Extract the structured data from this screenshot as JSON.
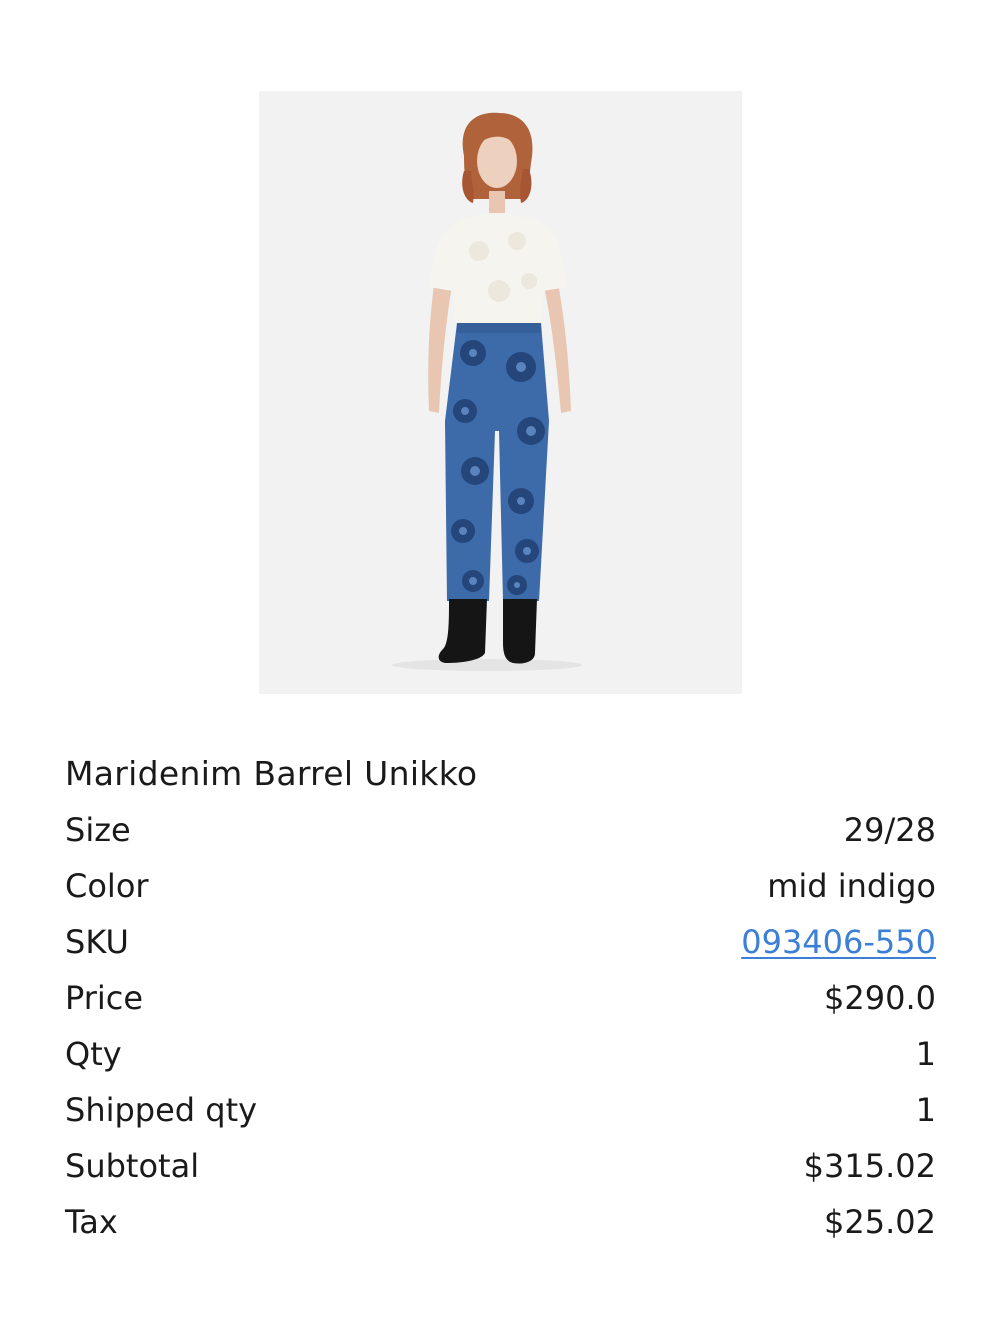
{
  "product": {
    "name": "Maridenim Barrel Unikko",
    "image_alt": "Model wearing Maridenim Barrel Unikko jeans"
  },
  "details": [
    {
      "key": "size",
      "label": "Size",
      "value": "29/28",
      "link": false
    },
    {
      "key": "color",
      "label": "Color",
      "value": "mid indigo",
      "link": false
    },
    {
      "key": "sku",
      "label": "SKU",
      "value": "093406-550",
      "link": true
    },
    {
      "key": "price",
      "label": "Price",
      "value": "$290.0",
      "link": false
    },
    {
      "key": "qty",
      "label": "Qty",
      "value": "1",
      "link": false
    },
    {
      "key": "shipped-qty",
      "label": "Shipped qty",
      "value": "1",
      "link": false
    },
    {
      "key": "subtotal",
      "label": "Subtotal",
      "value": "$315.02",
      "link": false
    },
    {
      "key": "tax",
      "label": "Tax",
      "value": "$25.02",
      "link": false
    }
  ],
  "colors": {
    "link": "#3c7fd6",
    "text": "#1a1a1a",
    "image_bg": "#f2f2f2",
    "denim": "#3d6aa8",
    "denim_flower": "#24467a"
  }
}
